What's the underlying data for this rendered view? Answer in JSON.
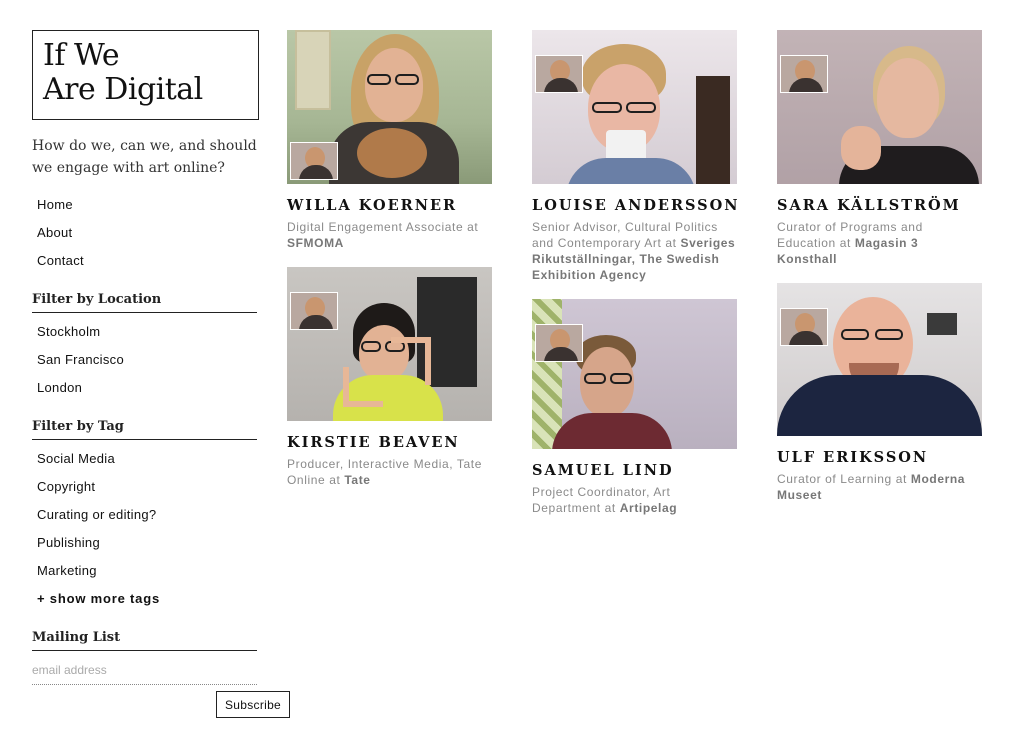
{
  "site": {
    "title_line1": "If We",
    "title_line2": "Are Digital",
    "tagline": "How do we, can we, and should we engage with art online?"
  },
  "nav": [
    {
      "label": "Home"
    },
    {
      "label": "About"
    },
    {
      "label": "Contact"
    }
  ],
  "filter_location": {
    "heading": "Filter by Location",
    "items": [
      {
        "label": "Stockholm"
      },
      {
        "label": "San Francisco"
      },
      {
        "label": "London"
      }
    ]
  },
  "filter_tag": {
    "heading": "Filter by Tag",
    "items": [
      {
        "label": "Social Media"
      },
      {
        "label": "Copyright"
      },
      {
        "label": "Curating or editing?"
      },
      {
        "label": "Publishing"
      },
      {
        "label": "Marketing"
      }
    ],
    "show_more": "+ show more tags"
  },
  "mailing": {
    "heading": "Mailing List",
    "placeholder": "email address",
    "button": "Subscribe"
  },
  "people": [
    {
      "name": "WILLA KOERNER",
      "role": "Digital Engagement Associate at",
      "org": "SFMOMA"
    },
    {
      "name": "KIRSTIE BEAVEN",
      "role": "Producer, Interactive Media, Tate Online at",
      "org": "Tate"
    },
    {
      "name": "LOUISE ANDERSSON",
      "role": "Senior Advisor, Cultural Politics and Contemporary Art at",
      "org": "Sveriges Rikutställningar, The Swedish Exhibition Agency"
    },
    {
      "name": "SAMUEL LIND",
      "role": "Project Coordinator, Art Department at",
      "org": "Artipelag"
    },
    {
      "name": "SARA KÄLLSTRÖM",
      "role": "Curator of Programs and Education at",
      "org": "Magasin 3 Konsthall"
    },
    {
      "name": "ULF ERIKSSON",
      "role": "Curator of Learning at",
      "org": "Moderna Museet"
    }
  ],
  "colors": {
    "text": "#111111",
    "muted": "#8a8a8a",
    "rule": "#222222"
  }
}
